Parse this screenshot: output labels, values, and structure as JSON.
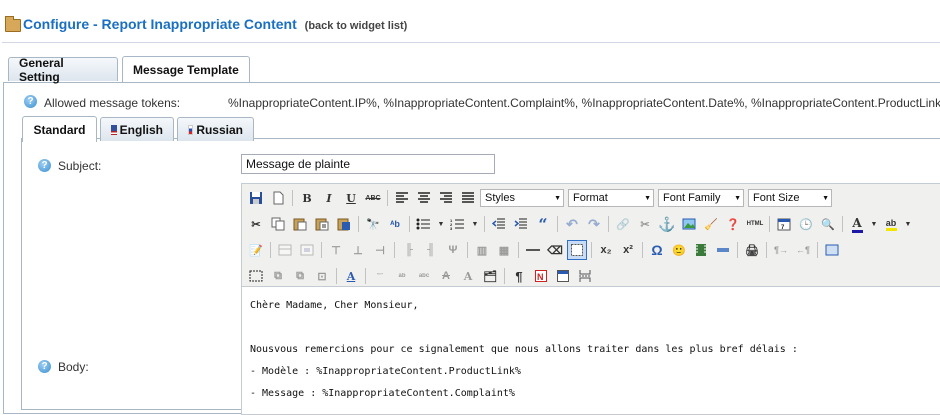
{
  "header": {
    "title": "Configure - Report Inappropriate Content",
    "back_link": "(back to widget list)"
  },
  "tabs": [
    {
      "label": "General Setting",
      "active": false
    },
    {
      "label": "Message Template",
      "active": true
    }
  ],
  "tokens": {
    "label": "Allowed message tokens:",
    "value": "%InappropriateContent.IP%, %InappropriateContent.Complaint%, %InappropriateContent.Date%, %InappropriateContent.ProductLink%"
  },
  "language_tabs": [
    {
      "label": "Standard",
      "active": true,
      "flag": null
    },
    {
      "label": "English",
      "active": false,
      "flag": "us-flag-icon"
    },
    {
      "label": "Russian",
      "active": false,
      "flag": "ru-flag-icon"
    }
  ],
  "subject": {
    "label": "Subject:",
    "value": "Message de plainte"
  },
  "body": {
    "label": "Body:"
  },
  "editor": {
    "dropdowns": {
      "styles": "Styles",
      "format": "Format",
      "font_family": "Font Family",
      "font_size": "Font Size"
    },
    "html_button": "HTML",
    "text_buttons": {
      "bold": "B",
      "italic": "I",
      "underline": "U",
      "strike": "ABC",
      "superscript": "x²",
      "subscript": "x₂",
      "omega": "Ω",
      "quote": "“"
    },
    "colors": {
      "text_color": "#1a1aa6",
      "highlight": "#f2e600",
      "accent": "#1a6fc2"
    },
    "content_lines": [
      "Chère Madame, Cher Monsieur,",
      "",
      "Nousvous remercions pour ce signalement que nous allons traiter dans les plus bref délais :",
      "- Modèle : %InappropriateContent.ProductLink%",
      "- Message : %InappropriateContent.Complaint%"
    ]
  }
}
